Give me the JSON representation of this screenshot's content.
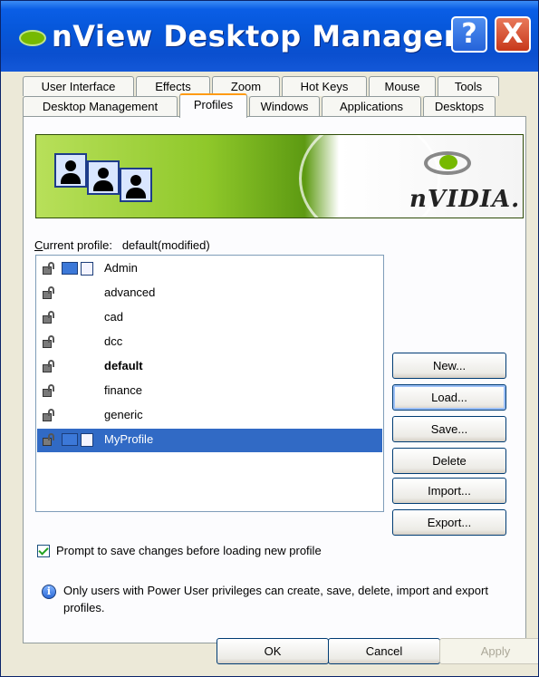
{
  "window": {
    "title": "nView Desktop Manager",
    "help_glyph": "?",
    "close_glyph": "X"
  },
  "tabs": {
    "row1": [
      "User Interface",
      "Effects",
      "Zoom",
      "Hot Keys",
      "Mouse",
      "Tools"
    ],
    "row2": [
      "Desktop Management",
      "Profiles",
      "Windows",
      "Applications",
      "Desktops"
    ],
    "active": "Profiles"
  },
  "banner": {
    "logo_text": "nVIDIA."
  },
  "profiles": {
    "current_label_prefix": "C",
    "current_label_rest": "urrent profile:",
    "current_value": "default(modified)",
    "items": [
      {
        "label": "Admin",
        "icons": true,
        "bold": false,
        "selected": false
      },
      {
        "label": "advanced",
        "icons": false,
        "bold": false,
        "selected": false
      },
      {
        "label": "cad",
        "icons": false,
        "bold": false,
        "selected": false
      },
      {
        "label": "dcc",
        "icons": false,
        "bold": false,
        "selected": false
      },
      {
        "label": "default",
        "icons": false,
        "bold": true,
        "selected": false
      },
      {
        "label": "finance",
        "icons": false,
        "bold": false,
        "selected": false
      },
      {
        "label": "generic",
        "icons": false,
        "bold": false,
        "selected": false
      },
      {
        "label": "MyProfile",
        "icons": true,
        "bold": false,
        "selected": true
      }
    ]
  },
  "side_buttons": {
    "new": "New...",
    "load": "Load...",
    "save": "Save...",
    "delete": "Delete",
    "import": "Import...",
    "export": "Export..."
  },
  "prompt_checkbox": {
    "label": "Prompt to save changes before loading new profile",
    "checked": true
  },
  "info": {
    "text": "Only users with Power User privileges can create, save, delete, import and export profiles."
  },
  "dialog_buttons": {
    "ok": "OK",
    "cancel": "Cancel",
    "apply": "Apply"
  },
  "colors": {
    "title_bar": "#0656d8",
    "selection": "#316ac5",
    "active_tab_accent": "#ff9b15",
    "nvidia_green": "#76b900"
  }
}
